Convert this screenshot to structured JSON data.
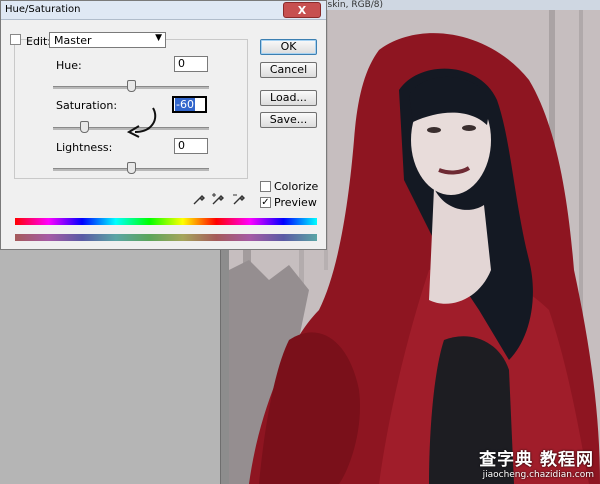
{
  "dialog": {
    "title": "Hue/Saturation",
    "close_label": "X",
    "edit": {
      "label": "Edit:",
      "selected": "Master"
    },
    "hue": {
      "label": "Hue:",
      "value": "0",
      "slider_fraction": 0.5
    },
    "saturation": {
      "label": "Saturation:",
      "value": "-60",
      "slider_fraction": 0.2
    },
    "lightness": {
      "label": "Lightness:",
      "value": "0",
      "slider_fraction": 0.5
    },
    "buttons": {
      "ok": "OK",
      "cancel": "Cancel",
      "load": "Load...",
      "save": "Save..."
    },
    "colorize": {
      "label": "Colorize",
      "checked": false
    },
    "preview": {
      "label": "Preview",
      "checked": true
    },
    "icons": [
      "eyedropper-icon",
      "eyedropper-plus-icon",
      "eyedropper-minus-icon"
    ],
    "accent": "#3266cc"
  },
  "document": {
    "title": "(skin, RGB/8)"
  },
  "watermark": {
    "title": "查字典 教程网",
    "url": "jiaocheng.chazidian.com"
  },
  "colors": {
    "cloak": "#8e1521",
    "hair": "#141923",
    "skin": "#e8dcda",
    "background": "#c6bebf"
  }
}
